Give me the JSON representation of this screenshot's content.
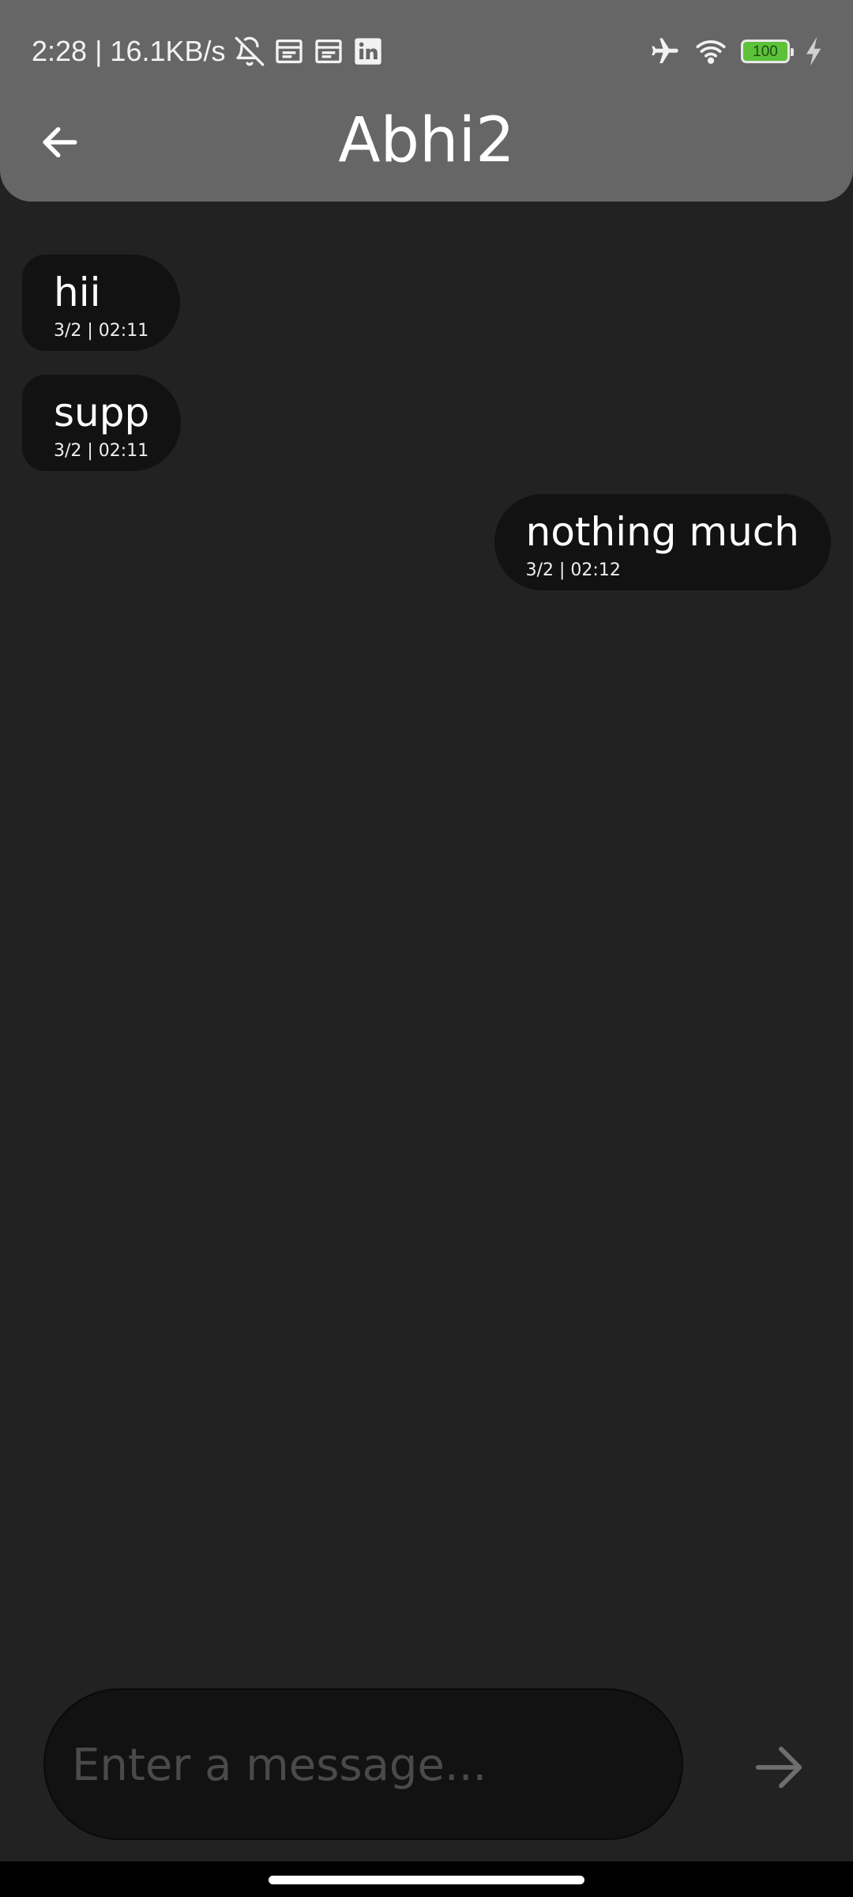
{
  "status_bar": {
    "time_speed": "2:28 | 16.1KB/s",
    "left_icons": [
      "bell-off-icon",
      "calendar-icon",
      "calendar-icon",
      "linkedin-icon"
    ],
    "right_icons": [
      "airplane-icon",
      "wifi-icon",
      "battery-icon",
      "charging-icon"
    ],
    "battery_level": "100"
  },
  "header": {
    "back_icon": "arrow-left-icon",
    "title": "Abhi2"
  },
  "messages": [
    {
      "direction": "incoming",
      "text": "hii",
      "time": "3/2 | 02:11"
    },
    {
      "direction": "incoming",
      "text": "supp",
      "time": "3/2 | 02:11"
    },
    {
      "direction": "outgoing",
      "text": "nothing much",
      "time": "3/2 | 02:12"
    }
  ],
  "composer": {
    "placeholder": "Enter a message...",
    "value": "",
    "send_icon": "arrow-right-icon"
  },
  "colors": {
    "background": "#222222",
    "header": "#666666",
    "bubble": "#121212",
    "battery": "#5cc23a",
    "placeholder": "#4a4a4a"
  }
}
